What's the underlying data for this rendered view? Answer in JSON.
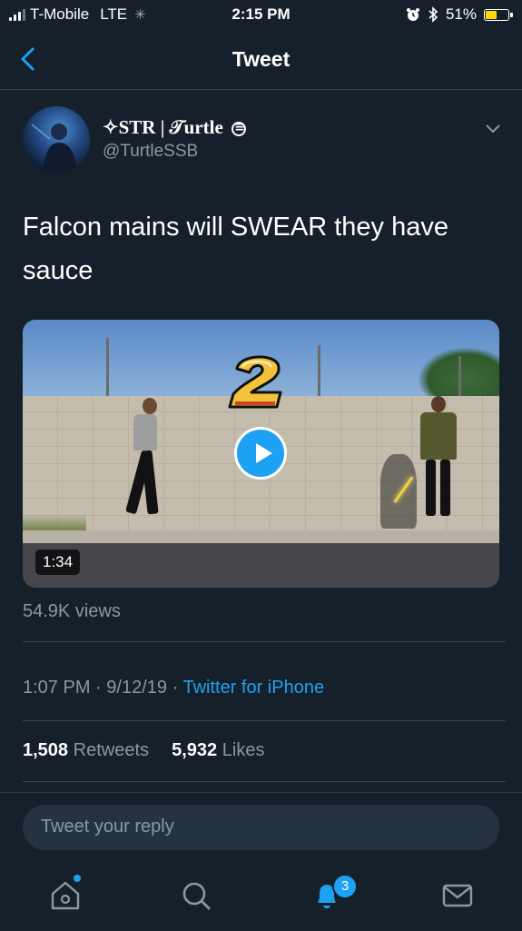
{
  "status_bar": {
    "carrier": "T-Mobile",
    "network": "LTE",
    "time": "2:15 PM",
    "battery_percent": "51%",
    "battery_level": 0.51,
    "icons": [
      "signal-icon",
      "loading-spinner-icon",
      "alarm-icon",
      "bluetooth-icon",
      "battery-icon"
    ]
  },
  "nav": {
    "title": "Tweet",
    "back_icon": "chevron-left-icon"
  },
  "tweet": {
    "display_name": "✧STR | 𝒯urtle",
    "handle": "@TurtleSSB",
    "text": "Falcon mains will SWEAR they have sauce",
    "video": {
      "duration": "1:34",
      "play_icon": "play-icon"
    },
    "views": "54.9K views",
    "time": "1:07 PM",
    "separator": "·",
    "date": "9/12/19",
    "source": "Twitter for iPhone",
    "retweets_count": "1,508",
    "retweets_label": "Retweets",
    "likes_count": "5,932",
    "likes_label": "Likes"
  },
  "reply": {
    "placeholder": "Tweet your reply"
  },
  "tab_bar": {
    "items": [
      "home-icon",
      "search-icon",
      "notifications-icon",
      "messages-icon"
    ],
    "notifications_badge": "3"
  },
  "colors": {
    "background": "#15202b",
    "accent": "#1da1f2",
    "secondary_text": "#8899a6",
    "divider": "#38444d"
  }
}
